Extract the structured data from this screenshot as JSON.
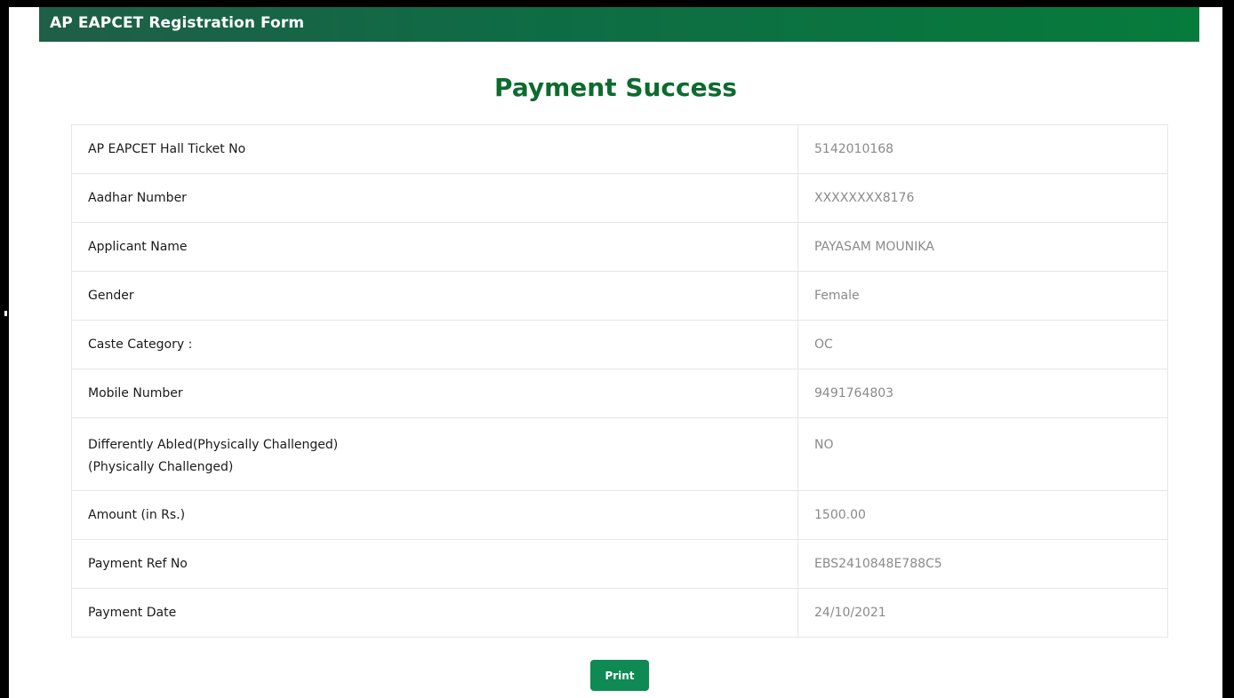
{
  "header": {
    "title": "AP EAPCET Registration Form"
  },
  "page_title": "Payment Success",
  "details": [
    {
      "label": "AP EAPCET Hall Ticket No",
      "value": "5142010168"
    },
    {
      "label": "Aadhar Number",
      "value": "XXXXXXXX8176"
    },
    {
      "label": "Applicant Name",
      "value": "PAYASAM MOUNIKA"
    },
    {
      "label": "Gender",
      "value": "Female"
    },
    {
      "label": "Caste Category :",
      "value": "OC"
    },
    {
      "label": "Mobile Number",
      "value": "9491764803"
    },
    {
      "label": "Differently Abled(Physically Challenged)",
      "label_line2": "(Physically Challenged)",
      "value": "NO"
    },
    {
      "label": "Amount (in Rs.)",
      "value": "1500.00"
    },
    {
      "label": "Payment Ref No",
      "value": "EBS2410848E788C5"
    },
    {
      "label": "Payment Date",
      "value": "24/10/2021"
    }
  ],
  "actions": {
    "print_label": "Print"
  },
  "colors": {
    "header_bg": "#0f6b45",
    "title_green": "#0d6b2e",
    "button_green": "#0f8a55"
  }
}
